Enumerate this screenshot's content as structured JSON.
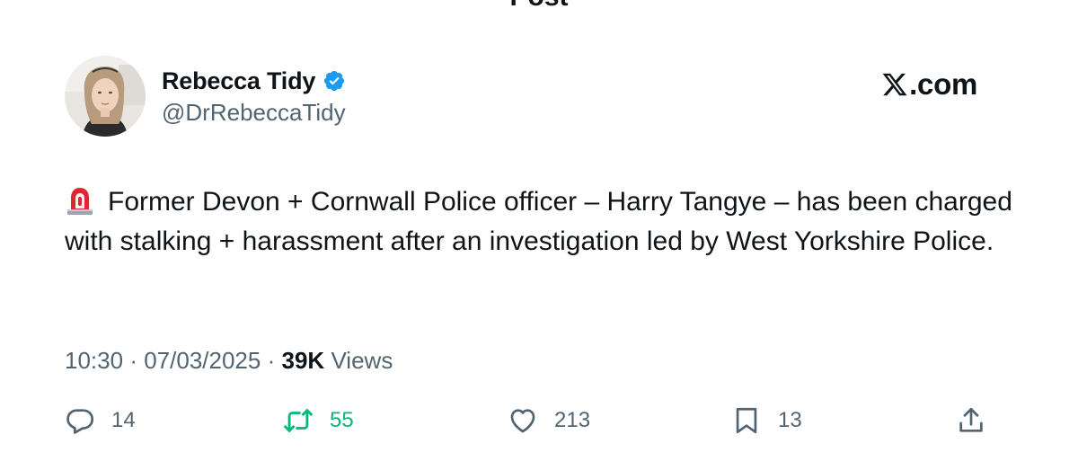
{
  "header": {
    "title": "Post"
  },
  "author": {
    "name": "Rebecca Tidy",
    "handle": "@DrRebeccaTidy",
    "verified": true,
    "verified_color": "#1d9bf0"
  },
  "brand": {
    "text": ".com",
    "icon": "x-logo-icon"
  },
  "tweet": {
    "emoji_icon": "police-siren-icon",
    "text": "Former Devon + Cornwall Police officer – Harry Tangye – has been charged with stalking + harassment after an investigation led by West Yorkshire Police."
  },
  "meta": {
    "time": "10:30",
    "separator": "·",
    "date": "07/03/2025",
    "views_count": "39K",
    "views_label": "Views"
  },
  "actions": {
    "replies": "14",
    "reposts": "55",
    "likes": "213",
    "bookmarks": "13"
  },
  "colors": {
    "text_primary": "#0f1419",
    "text_secondary": "#536471",
    "repost_active": "#00ba7c",
    "verified": "#1d9bf0"
  }
}
